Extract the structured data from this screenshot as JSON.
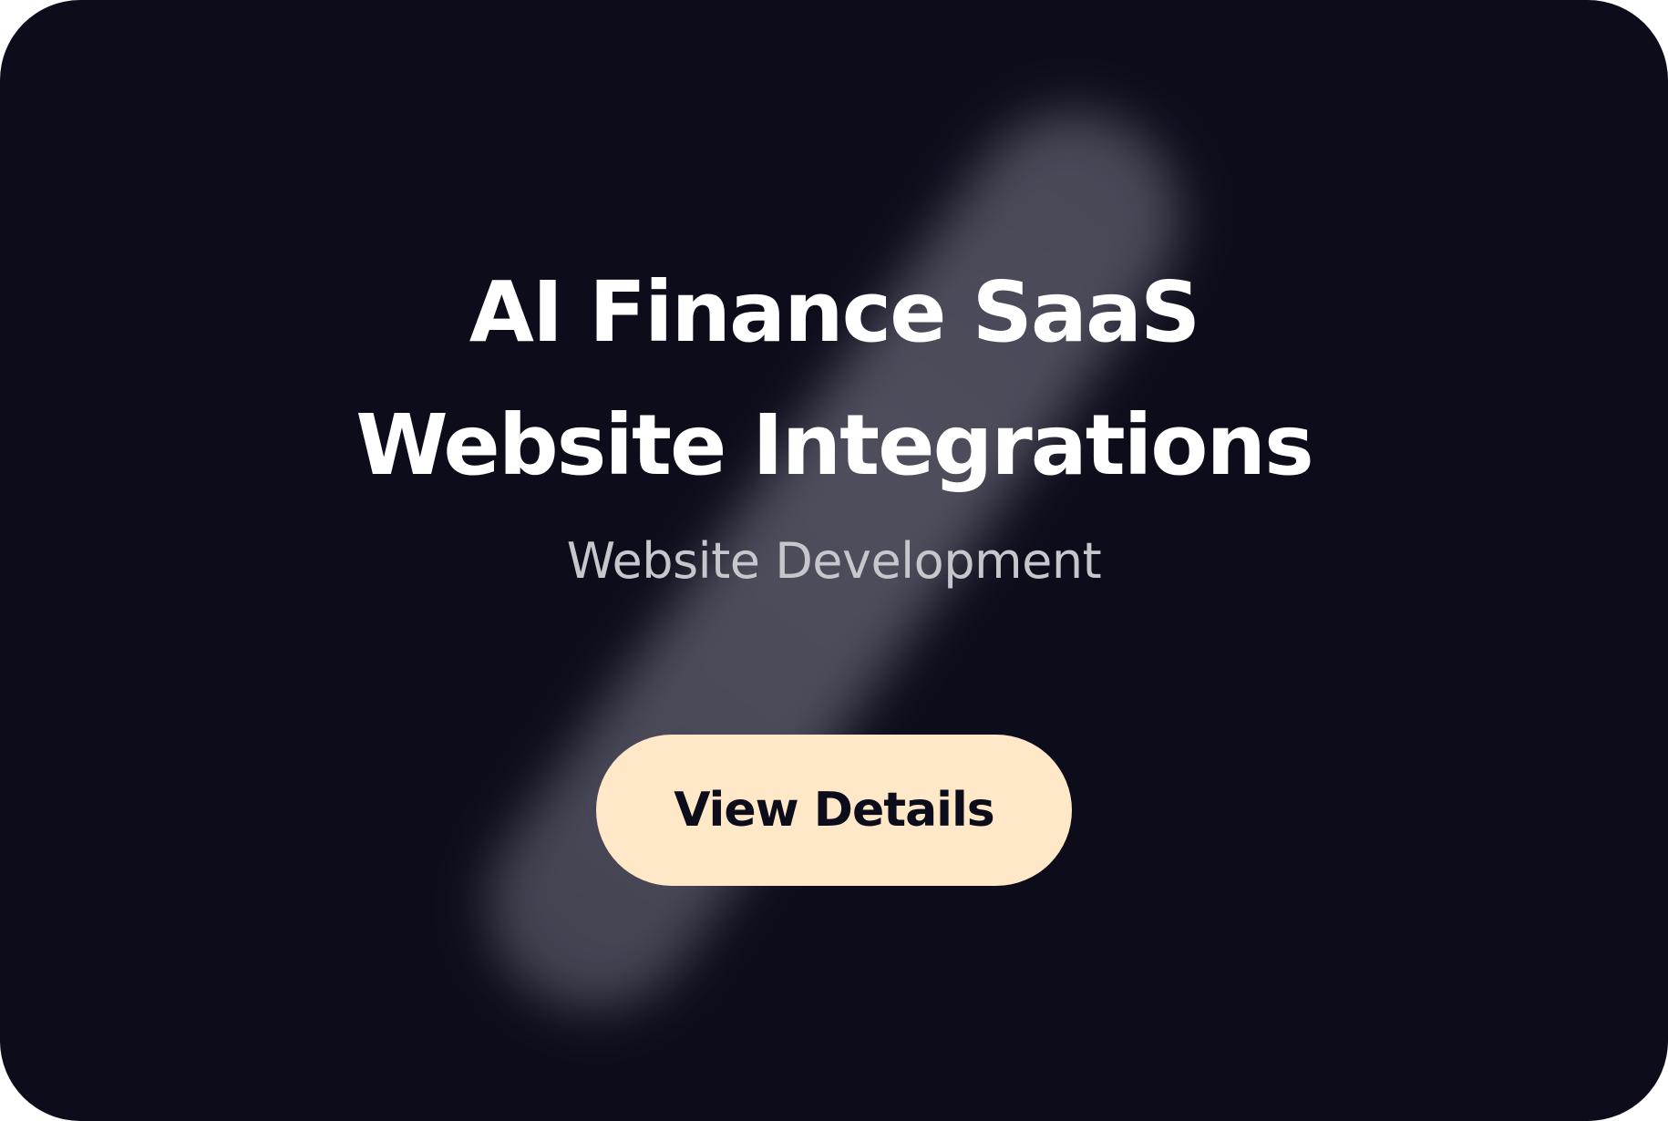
{
  "card": {
    "title_line1": "AI Finance SaaS",
    "title_line2": "Website Integrations",
    "subtitle": "Website Development",
    "cta_label": "View Details"
  },
  "colors": {
    "background": "#0c0c1b",
    "title": "#ffffff",
    "subtitle": "#c6c6cc",
    "button_bg": "#fee8c7",
    "button_text": "#0c0c1b"
  }
}
